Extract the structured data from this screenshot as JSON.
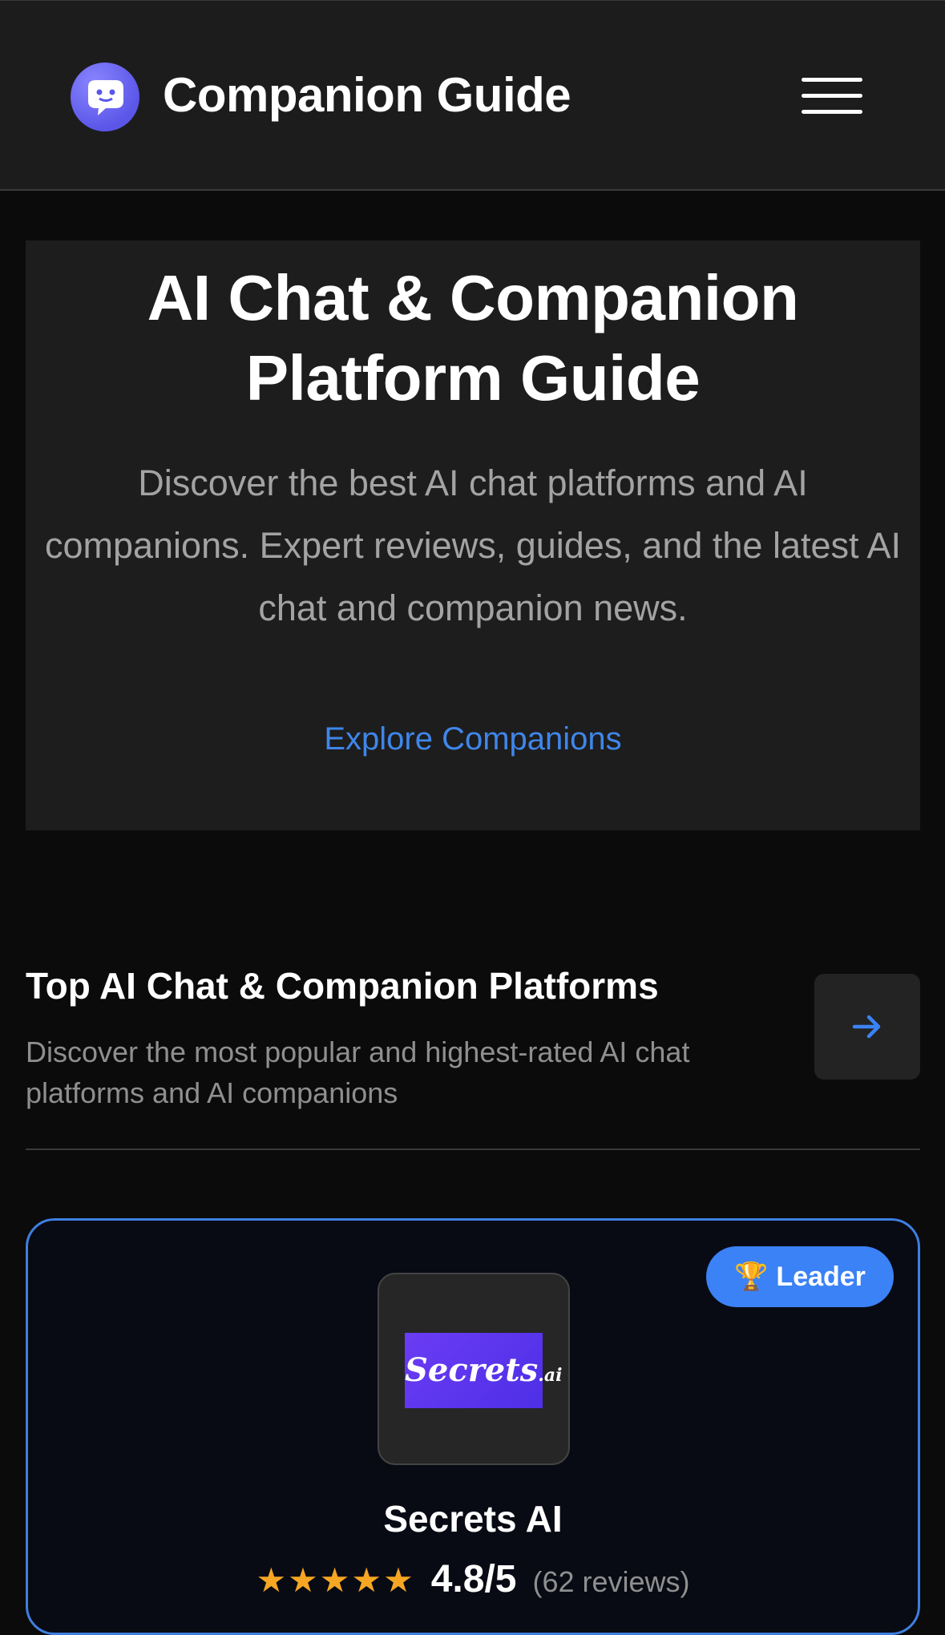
{
  "header": {
    "brand": "Companion Guide",
    "logo_icon": "chat-bubble-logo-icon",
    "menu_icon": "hamburger-menu-icon"
  },
  "hero": {
    "title": "AI Chat & Companion Platform Guide",
    "subtitle": "Discover the best AI chat platforms and AI companions. Expert reviews, guides, and the latest AI chat and companion news.",
    "cta": "Explore Companions"
  },
  "section": {
    "title": "Top AI Chat & Companion Platforms",
    "description": "Discover the most popular and highest-rated AI chat platforms and AI companions",
    "arrow_icon": "arrow-right-icon"
  },
  "card": {
    "badge_icon": "trophy-icon",
    "badge": "Leader",
    "logo_text": "Secrets",
    "logo_suffix": ".ai",
    "name": "Secrets AI",
    "stars": "★★★★★",
    "rating_value": 4.8,
    "score": "4.8/5",
    "reviews": "(62 reviews)"
  },
  "colors": {
    "background": "#0b0b0b",
    "header": "#1c1c1c",
    "hero": "#1d1d1d",
    "accent": "#3b82f6",
    "link": "#3f86ea",
    "star": "#f5a623",
    "logo": "#6b3cf4"
  }
}
